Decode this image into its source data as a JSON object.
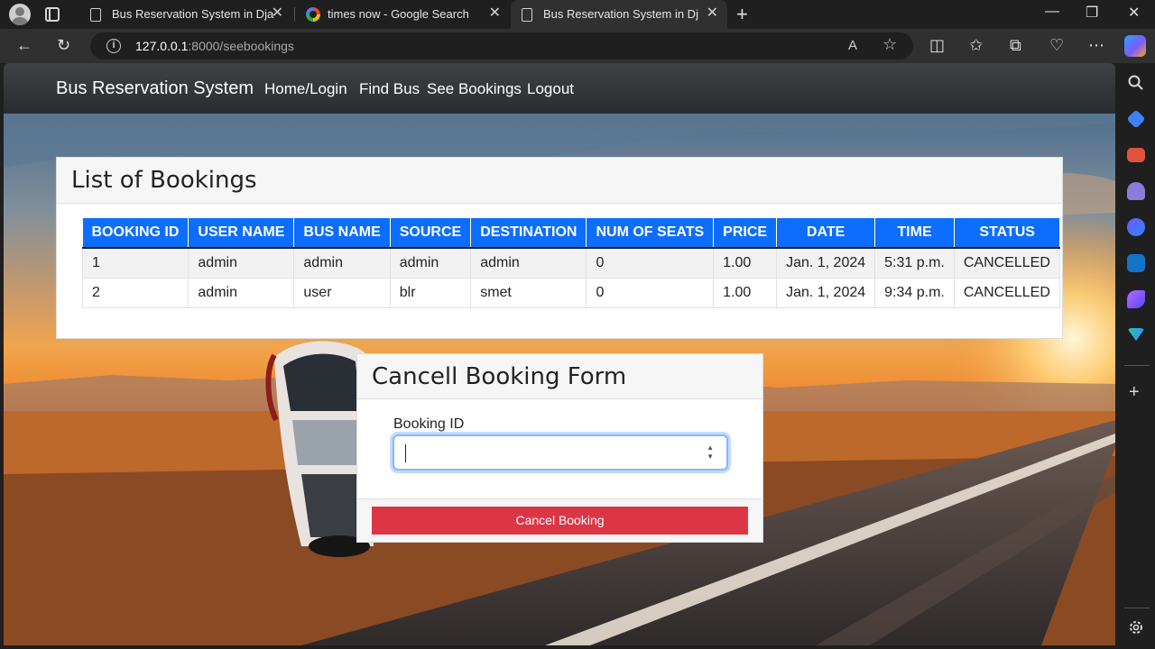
{
  "browser": {
    "tabs": [
      {
        "title": "Bus Reservation System in Djang",
        "favicon": "page-icon",
        "active": false
      },
      {
        "title": "times now - Google Search",
        "favicon": "google-icon",
        "active": false
      },
      {
        "title": "Bus Reservation System in Djang",
        "favicon": "page-icon",
        "active": true
      }
    ],
    "close_glyph": "✕",
    "new_tab_glyph": "+",
    "window_controls": {
      "minimize": "—",
      "restore": "❐",
      "close": "✕"
    },
    "address": {
      "host": "127.0.0.1",
      "path": ":8000/seebookings",
      "info_glyph": "i"
    },
    "toolbar_glyphs": {
      "back": "←",
      "reload": "↻",
      "read_aloud": "A",
      "favorite": "☆",
      "split": "◫",
      "favorites": "✩",
      "collections": "⧉",
      "health": "♡",
      "more": "⋯"
    }
  },
  "navbar": {
    "brand": "Bus Reservation System",
    "links": [
      "Home/Login",
      "Find Bus",
      "See Bookings",
      "Logout"
    ]
  },
  "bookings": {
    "title": "List of Bookings",
    "columns": [
      "BOOKING ID",
      "USER NAME",
      "BUS NAME",
      "SOURCE",
      "DESTINATION",
      "NUM OF SEATS",
      "PRICE",
      "DATE",
      "TIME",
      "STATUS"
    ],
    "rows": [
      [
        "1",
        "admin",
        "admin",
        "admin",
        "admin",
        "0",
        "1.00",
        "Jan. 1, 2024",
        "5:31 p.m.",
        "CANCELLED"
      ],
      [
        "2",
        "admin",
        "user",
        "blr",
        "smet",
        "0",
        "1.00",
        "Jan. 1, 2024",
        "9:34 p.m.",
        "CANCELLED"
      ]
    ]
  },
  "cancel_form": {
    "title": "Cancell Booking Form",
    "field_label": "Booking ID",
    "field_value": "",
    "spin_up": "▲",
    "spin_down": "▼",
    "submit_label": "Cancel Booking"
  },
  "colors": {
    "header_blue": "#0d6efd",
    "danger_red": "#dc3545"
  }
}
